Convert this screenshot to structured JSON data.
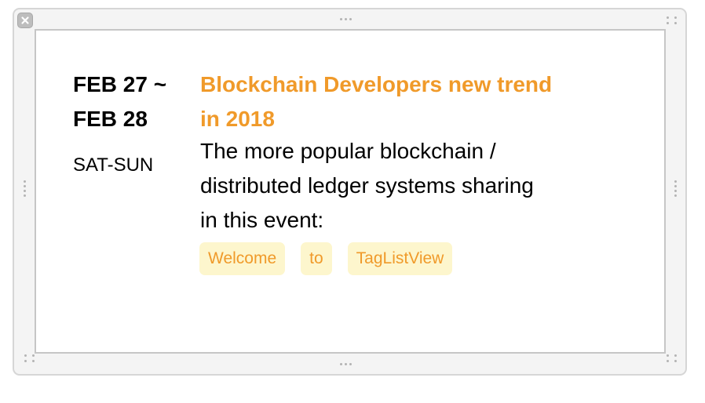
{
  "event": {
    "date_start": "FEB 27 ~",
    "date_end": "FEB 28",
    "day_range": "SAT-SUN",
    "title_lines": [
      "Blockchain Developers new trend",
      "in 2018"
    ],
    "description_lines": [
      "The more popular blockchain /",
      "distributed ledger systems sharing",
      "in this event:"
    ]
  },
  "tags": [
    "Welcome",
    "to",
    "TagListView"
  ],
  "colors": {
    "accent": "#f09a2a",
    "tag_background": "#fdf6cd",
    "frame_border": "#d6d6d6"
  },
  "icons": {
    "close": "close-icon",
    "grips": "resize-grip-icon"
  }
}
